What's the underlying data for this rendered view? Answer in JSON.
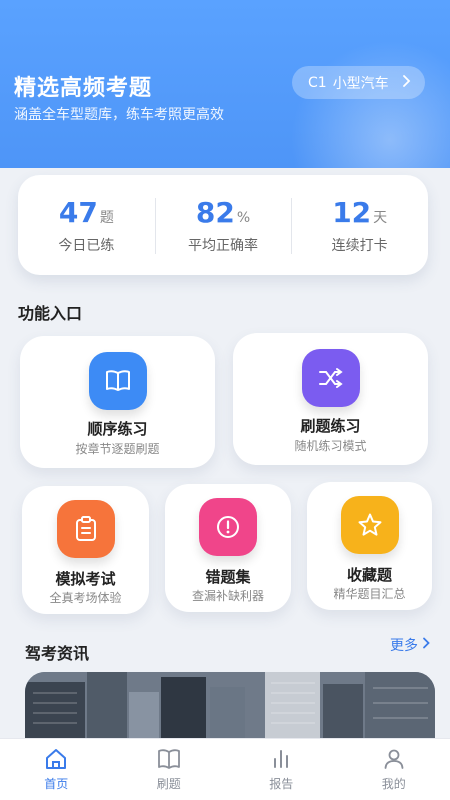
{
  "hero": {
    "title": "精选高频考题",
    "subtitle": "涵盖全车型题库，练车考照更高效",
    "car_chip": {
      "code": "C1",
      "label": "小型汽车"
    }
  },
  "stats": [
    {
      "value": "47",
      "unit": "题",
      "label": "今日已练"
    },
    {
      "value": "82",
      "unit": "%",
      "label": "平均正确率"
    },
    {
      "value": "12",
      "unit": "天",
      "label": "连续打卡"
    }
  ],
  "features": {
    "section_title": "功能入口",
    "items": [
      {
        "title": "顺序练习",
        "desc": "按章节逐题刷题",
        "icon": "book-icon",
        "color": "#3d8bf5"
      },
      {
        "title": "刷题练习",
        "desc": "随机练习模式",
        "icon": "shuffle-icon",
        "color": "#7b5cf0"
      },
      {
        "title": "模拟考试",
        "desc": "全真考场体验",
        "icon": "clipboard-icon",
        "color": "#f6743b"
      },
      {
        "title": "错题集",
        "desc": "查漏补缺利器",
        "icon": "alert-icon",
        "color": "#f0458a"
      },
      {
        "title": "收藏题",
        "desc": "精华题目汇总",
        "icon": "star-icon",
        "color": "#f7b21b"
      }
    ]
  },
  "news": {
    "section_title": "驾考资讯",
    "more_label": "更多"
  },
  "tabbar": [
    {
      "label": "首页",
      "icon": "home-icon",
      "active": true
    },
    {
      "label": "刷题",
      "icon": "book-icon",
      "active": false
    },
    {
      "label": "报告",
      "icon": "bar-chart-icon",
      "active": false
    },
    {
      "label": "我的",
      "icon": "user-icon",
      "active": false
    }
  ],
  "colors": {
    "accent": "#3a7bea",
    "hero": "#5aa2ff"
  }
}
